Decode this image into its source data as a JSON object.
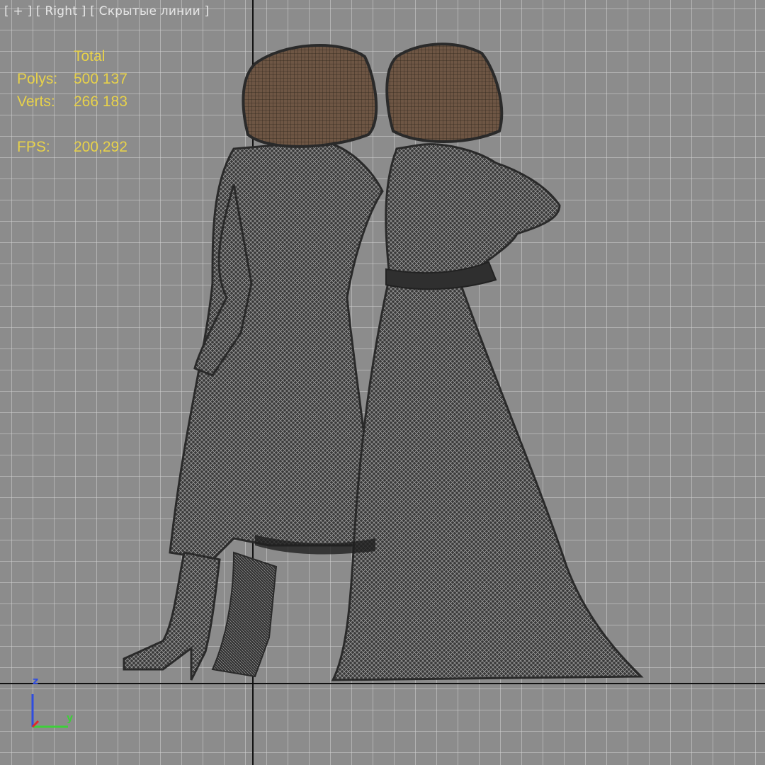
{
  "viewport": {
    "label": {
      "plus": "[ + ]",
      "view": "[ Right ]",
      "mode": "[ Скрытые линии ]"
    }
  },
  "stats": {
    "header": "Total",
    "polys_label": "Polys:",
    "polys_value": "500 137",
    "verts_label": "Verts:",
    "verts_value": "266 183",
    "fps_label": "FPS:",
    "fps_value": "200,292",
    "color": "#e8d24a"
  },
  "gizmo": {
    "z_label": "z",
    "y_label": "y",
    "z_color": "#2f4de0",
    "y_color": "#3ecf3a",
    "x_color": "#e02a2a"
  },
  "scene": {
    "figure_color": "#3a3a3a",
    "hair_color": "#6e5644",
    "wire_color": "#cfcfcf"
  }
}
